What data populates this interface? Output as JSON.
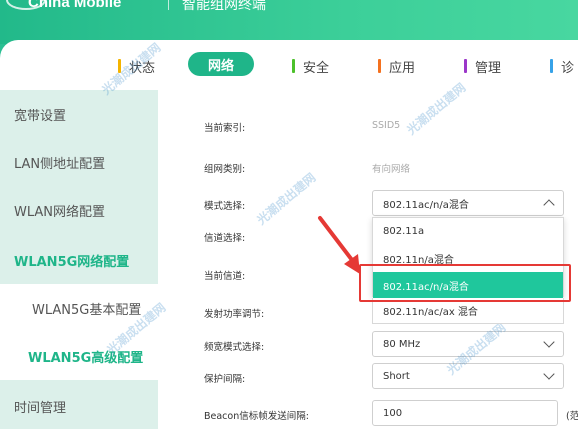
{
  "header": {
    "brand": "China Mobile",
    "subtitle": "智能组网终端"
  },
  "tabs": [
    {
      "label": "状态",
      "color": "#f4b400"
    },
    {
      "label": "网络",
      "active": true
    },
    {
      "label": "安全",
      "color": "#4cc12b"
    },
    {
      "label": "应用",
      "color": "#f4711f"
    },
    {
      "label": "管理",
      "color": "#9b37c9"
    },
    {
      "label": "诊",
      "color": "#36a2e8"
    }
  ],
  "sidebar": {
    "items": [
      {
        "label": "宽带设置"
      },
      {
        "label": "LAN侧地址配置"
      },
      {
        "label": "WLAN网络配置"
      },
      {
        "label": "WLAN5G网络配置"
      },
      {
        "label": "WLAN5G基本配置"
      },
      {
        "label": "WLAN5G高级配置"
      },
      {
        "label": "时间管理"
      }
    ]
  },
  "form": {
    "current_index_label": "当前索引:",
    "current_index_value": "SSID5",
    "network_type_label": "组网类别:",
    "network_type_value": "有向网络",
    "mode_label": "模式选择:",
    "mode_value": "802.11ac/n/a混合",
    "channel_label": "信道选择:",
    "current_channel_label": "当前信道:",
    "tx_power_label": "发射功率调节:",
    "bandwidth_label": "频宽模式选择:",
    "bandwidth_value": "80 MHz",
    "guard_label": "保护间隔:",
    "guard_value": "Short",
    "beacon_label": "Beacon信标帧发送间隔:",
    "beacon_value": "100",
    "beacon_suffix": "(范"
  },
  "mode_dropdown": {
    "options": [
      "802.11a",
      "802.11n/a混合",
      "802.11ac/n/a混合",
      "802.11n/ac/ax 混合"
    ],
    "selected_index": 2
  },
  "watermark": "光潮成出建网",
  "colors": {
    "accent": "#1fb589",
    "selected": "#1fc79c",
    "highlight": "#e53935"
  }
}
